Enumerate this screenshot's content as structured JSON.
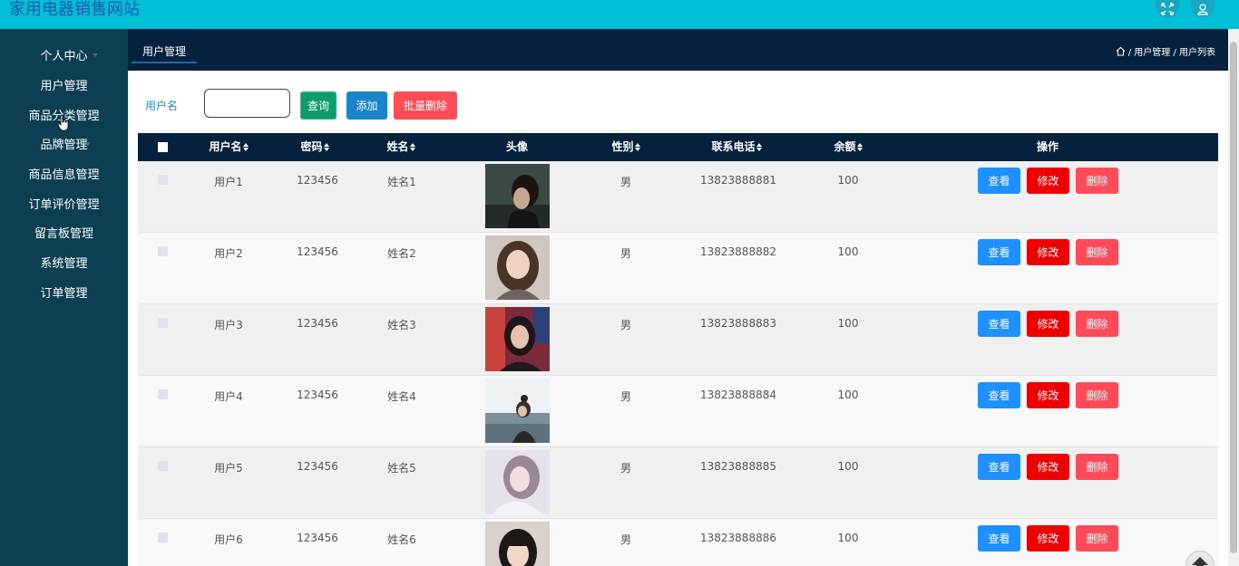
{
  "app": {
    "title": "家用电器销售网站"
  },
  "sidebar": {
    "items": [
      {
        "label": "个人中心",
        "has_submenu": true
      },
      {
        "label": "用户管理",
        "has_submenu": false
      },
      {
        "label": "商品分类管理",
        "has_submenu": true
      },
      {
        "label": "品牌管理",
        "has_submenu": true
      },
      {
        "label": "商品信息管理",
        "has_submenu": true
      },
      {
        "label": "订单评价管理",
        "has_submenu": true
      },
      {
        "label": "留言板管理",
        "has_submenu": true
      },
      {
        "label": "系统管理",
        "has_submenu": false
      },
      {
        "label": "订单管理",
        "has_submenu": false
      }
    ]
  },
  "breadcrumb": {
    "tab": "用户管理",
    "path": "/ 用户管理 / 用户列表"
  },
  "search": {
    "label": "用户名",
    "value": "",
    "query_button": "查询",
    "add_button": "添加",
    "batch_delete_button": "批量删除"
  },
  "table": {
    "columns": [
      "用户名",
      "密码",
      "姓名",
      "头像",
      "性别",
      "联系电话",
      "余额",
      "操作"
    ],
    "rows": [
      {
        "username": "用户1",
        "password": "123456",
        "name": "姓名1",
        "gender": "男",
        "phone": "13823888881",
        "balance": "100"
      },
      {
        "username": "用户2",
        "password": "123456",
        "name": "姓名2",
        "gender": "男",
        "phone": "13823888882",
        "balance": "100"
      },
      {
        "username": "用户3",
        "password": "123456",
        "name": "姓名3",
        "gender": "男",
        "phone": "13823888883",
        "balance": "100"
      },
      {
        "username": "用户4",
        "password": "123456",
        "name": "姓名4",
        "gender": "男",
        "phone": "13823888884",
        "balance": "100"
      },
      {
        "username": "用户5",
        "password": "123456",
        "name": "姓名5",
        "gender": "男",
        "phone": "13823888885",
        "balance": "100"
      },
      {
        "username": "用户6",
        "password": "123456",
        "name": "姓名6",
        "gender": "男",
        "phone": "13823888886",
        "balance": "100"
      }
    ],
    "actions": {
      "view": "查看",
      "edit": "修改",
      "delete": "删除"
    }
  },
  "colors": {
    "header": "#00c0d8",
    "sidebar": "#0d3f52",
    "table_header": "#04213e",
    "view": "#1e90ff",
    "edit": "#ee0000",
    "delete": "#ff4a5a"
  }
}
